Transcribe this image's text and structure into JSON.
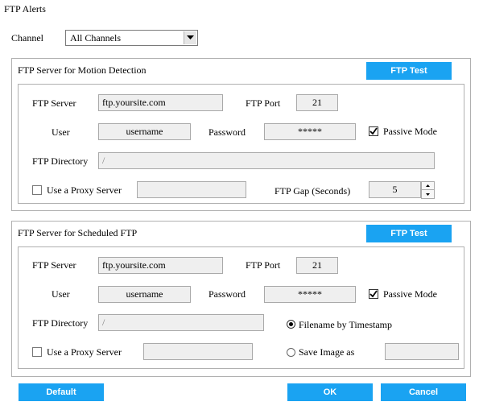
{
  "window": {
    "title": "FTP Alerts"
  },
  "channel": {
    "label": "Channel",
    "selected": "All Channels"
  },
  "motion": {
    "heading": "FTP Server for Motion Detection",
    "test_button": "FTP Test",
    "server_label": "FTP Server",
    "server_value": "ftp.yoursite.com",
    "port_label": "FTP Port",
    "port_value": "21",
    "user_label": "User",
    "user_value": "username",
    "password_label": "Password",
    "password_value": "*****",
    "passive_label": "Passive Mode",
    "passive_checked": true,
    "directory_label": "FTP Directory",
    "directory_value": "/",
    "proxy_label": "Use a Proxy Server",
    "proxy_checked": false,
    "proxy_value": "",
    "gap_label": "FTP Gap (Seconds)",
    "gap_value": "5"
  },
  "scheduled": {
    "heading": "FTP Server for Scheduled FTP",
    "test_button": "FTP Test",
    "server_label": "FTP Server",
    "server_value": "ftp.yoursite.com",
    "port_label": "FTP Port",
    "port_value": "21",
    "user_label": "User",
    "user_value": "username",
    "password_label": "Password",
    "password_value": "*****",
    "passive_label": "Passive Mode",
    "passive_checked": true,
    "directory_label": "FTP Directory",
    "directory_value": "/",
    "proxy_label": "Use a Proxy Server",
    "proxy_checked": false,
    "proxy_value": "",
    "filename_timestamp_label": "Filename by Timestamp",
    "filename_timestamp_selected": true,
    "save_image_label": "Save Image as",
    "save_image_selected": false,
    "save_image_value": ""
  },
  "footer": {
    "default_button": "Default",
    "ok_button": "OK",
    "cancel_button": "Cancel"
  },
  "colors": {
    "accent": "#1aa3f2",
    "field_bg": "#efefef",
    "border": "#b0b0b0"
  }
}
